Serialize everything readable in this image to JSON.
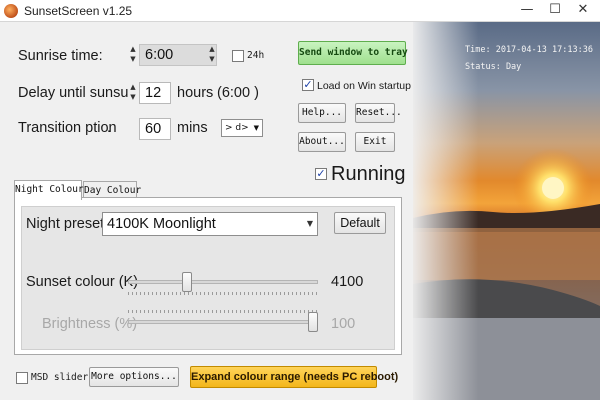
{
  "window": {
    "title": "SunsetScreen v1.25",
    "minimize_glyph": "—",
    "maximize_glyph": "☐",
    "close_glyph": "✕"
  },
  "settings": {
    "sunrise_label": "Sunrise time:",
    "sunrise_value": "6:00",
    "h24_label": "24h",
    "delay_label": "Delay until sunsu",
    "delay_value": "12",
    "delay_unit": "hours",
    "delay_computed": "(6:00 )",
    "transition_label": "Transition ption",
    "transition_dot": ".",
    "transition_value": "60",
    "transition_unit": "mins",
    "transition_mode": "> d>"
  },
  "actions": {
    "send_to_tray": "Send window to tray",
    "load_startup_label": "Load on Win startup",
    "help": "Help...",
    "reset": "Reset...",
    "about": "About...",
    "exit": "Exit",
    "running_label": "Running",
    "running_checked": true,
    "load_startup_checked": true
  },
  "tabs": [
    {
      "label": "Night Colour",
      "active": true
    },
    {
      "label": "Day Colour",
      "active": false
    }
  ],
  "night": {
    "preset_label": "Night preset:",
    "preset_value": "4100K Moonlight",
    "default_button": "Default",
    "sunset_colour_label": "Sunset colour (K)",
    "sunset_colour_value": "4100",
    "sunset_colour_fraction": 0.3,
    "brightness_label": "Brightness (%)",
    "brightness_value": "100",
    "brightness_fraction": 1.0
  },
  "bottom": {
    "msd_sliders_label": "MSD sliders",
    "more_options": "More options...",
    "expand_colour": "Expand colour range (needs PC reboot)"
  },
  "photo": {
    "time_text": "Time: 2017-04-13 17:13:36",
    "status_text": "Status: Day"
  },
  "icons": {
    "app": "sunset-app-icon",
    "spin": "up-down-spin-icon",
    "dropdown": "chevron-down-icon",
    "checkmark": "checkmark-icon"
  },
  "colors": {
    "send_button": "#9fe08e",
    "expand_button": "#f3b61a"
  }
}
